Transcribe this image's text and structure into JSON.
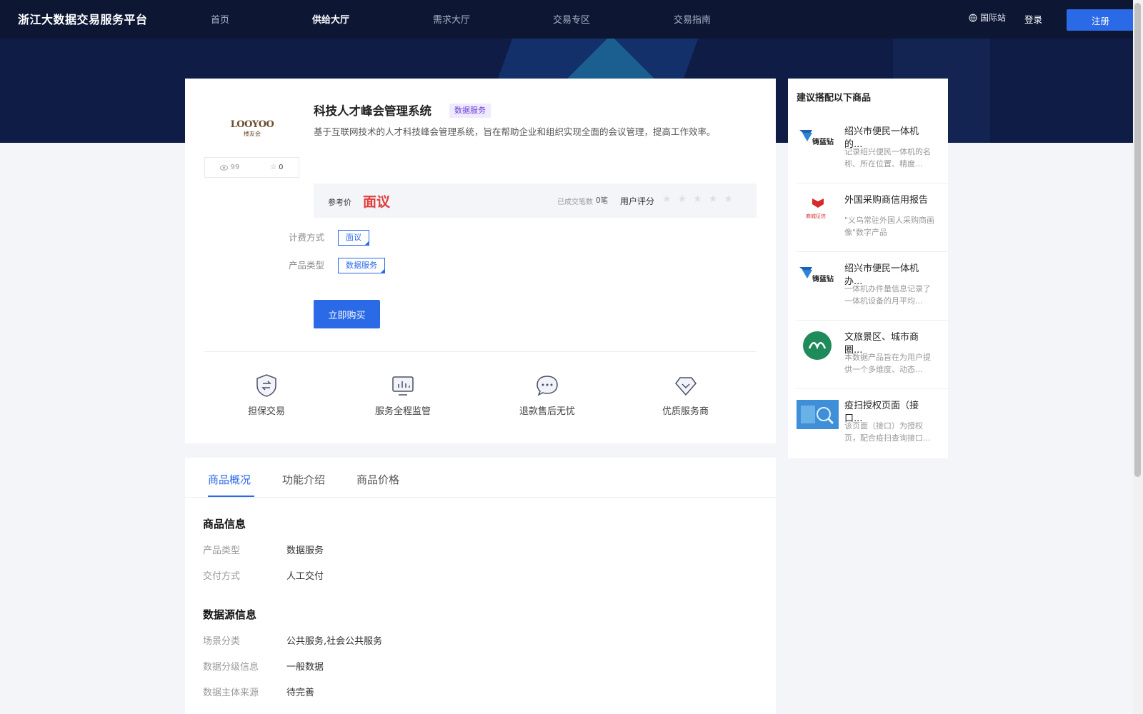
{
  "header": {
    "brand": "浙江大数据交易服务平台",
    "nav": [
      "首页",
      "供给大厅",
      "需求大厅",
      "交易专区",
      "交易指南"
    ],
    "intl_label": "国际站",
    "login_label": "登录",
    "register_label": "注册"
  },
  "product": {
    "logo_text": "LOOYOO",
    "logo_sub": "楼友会",
    "views": "99",
    "favorites": "0",
    "title": "科技人才峰会管理系统",
    "tag": "数据服务",
    "description": "基于互联网技术的人才科技峰会管理系统，旨在帮助企业和组织实现全面的会议管理，提高工作效率。",
    "price_label": "参考价",
    "price_value": "面议",
    "deals_label": "已成交笔数",
    "deals_value": "0笔",
    "rating_label": "用户评分",
    "rating": 0,
    "billing_label": "计费方式",
    "billing_value": "面议",
    "type_label": "产品类型",
    "type_value": "数据服务",
    "buy_label": "立即购买"
  },
  "features": [
    {
      "label": "担保交易",
      "icon": "shield-exchange-icon"
    },
    {
      "label": "服务全程监管",
      "icon": "monitor-chart-icon"
    },
    {
      "label": "退款售后无忧",
      "icon": "chat-bubble-icon"
    },
    {
      "label": "优质服务商",
      "icon": "diamond-icon"
    }
  ],
  "tabs": [
    "商品概况",
    "功能介绍",
    "商品价格"
  ],
  "product_info": {
    "title": "商品信息",
    "rows": [
      {
        "label": "产品类型",
        "value": "数据服务"
      },
      {
        "label": "交付方式",
        "value": "人工交付"
      }
    ]
  },
  "source_info": {
    "title": "数据源信息",
    "rows": [
      {
        "label": "场景分类",
        "value": "公共服务,社会公共服务"
      },
      {
        "label": "数据分级信息",
        "value": "一般数据"
      },
      {
        "label": "数据主体来源",
        "value": "待完善"
      }
    ]
  },
  "sidebar": {
    "title": "建议搭配以下商品",
    "items": [
      {
        "title": "绍兴市便民一体机的...",
        "desc": "记录绍兴便民一体机的名称、所在位置、精度...",
        "thumb": "铸蓝钻"
      },
      {
        "title": "外国采购商信用报告",
        "desc": "\"义乌常驻外国人采购商画像\"数字产品",
        "thumb": "商城征信"
      },
      {
        "title": "绍兴市便民一体机办...",
        "desc": "一体机办件量信息记录了一体机设备的月平均...",
        "thumb": "铸蓝钻"
      },
      {
        "title": "文旅景区、城市商圈...",
        "desc": "本数据产品旨在为用户提供一个多维度、动态...",
        "thumb": ""
      },
      {
        "title": "疫扫授权页面（接口...",
        "desc": "该页面（接口）为授权页，配合疫扫查询接口...",
        "thumb": ""
      }
    ]
  },
  "colors": {
    "accent": "#2b6ae6",
    "header_bg": "#0d1733",
    "price_red": "#e23b3b",
    "tag_purple": "#6a3ed6"
  }
}
